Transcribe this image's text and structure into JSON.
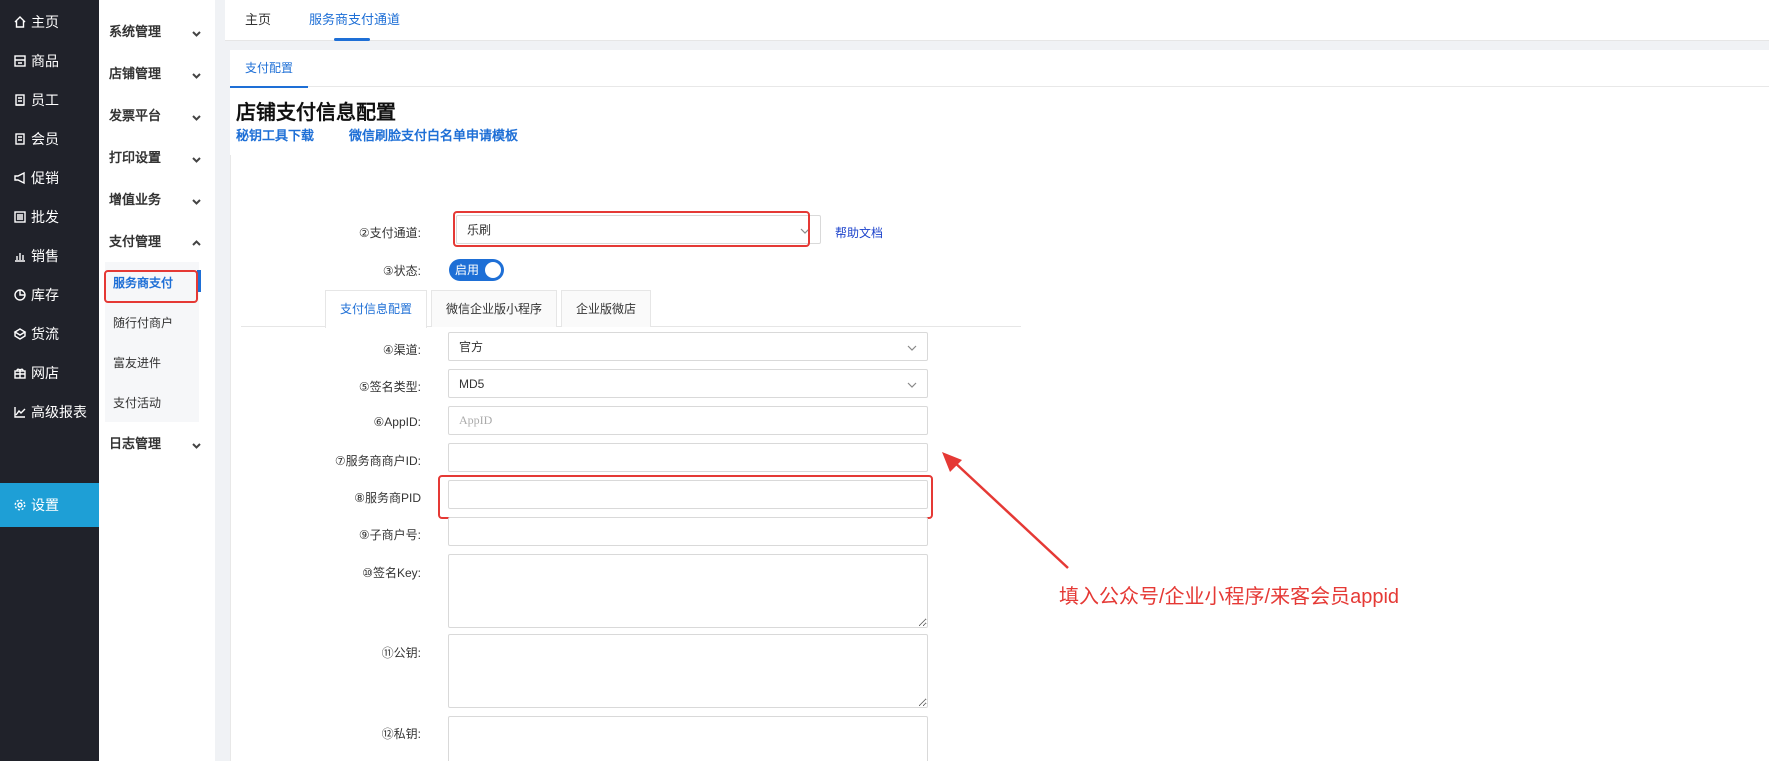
{
  "nav": {
    "items": [
      {
        "label": "主页",
        "icon": "home-icon"
      },
      {
        "label": "商品",
        "icon": "box-icon"
      },
      {
        "label": "员工",
        "icon": "staff-icon"
      },
      {
        "label": "会员",
        "icon": "member-icon"
      },
      {
        "label": "促销",
        "icon": "megaphone-icon"
      },
      {
        "label": "批发",
        "icon": "list-icon"
      },
      {
        "label": "销售",
        "icon": "bar-chart-icon"
      },
      {
        "label": "库存",
        "icon": "pie-chart-icon"
      },
      {
        "label": "货流",
        "icon": "cube-icon"
      },
      {
        "label": "网店",
        "icon": "gift-icon"
      },
      {
        "label": "高级报表",
        "icon": "line-chart-icon"
      },
      {
        "label": "设置",
        "icon": "gear-icon",
        "active": true
      }
    ]
  },
  "submenu": {
    "groups": [
      {
        "label": "系统管理"
      },
      {
        "label": "店铺管理"
      },
      {
        "label": "发票平台"
      },
      {
        "label": "打印设置"
      },
      {
        "label": "增值业务"
      },
      {
        "label": "支付管理",
        "expanded": true
      },
      {
        "label": "日志管理"
      }
    ],
    "children": [
      {
        "label": "服务商支付",
        "active": true
      },
      {
        "label": "随行付商户"
      },
      {
        "label": "富友进件"
      },
      {
        "label": "支付活动"
      }
    ]
  },
  "topbar": {
    "tabs": [
      {
        "label": "主页"
      },
      {
        "label": "服务商支付通道",
        "active": true
      }
    ]
  },
  "panel": {
    "tab": "支付配置",
    "title": "店铺支付信息配置",
    "links": [
      "秘钥工具下载",
      "微信刷脸支付白名单申请模板"
    ]
  },
  "form": {
    "channel_label": "②支付通道:",
    "channel_value": "乐刷",
    "help_link": "帮助文档",
    "status_label": "③状态:",
    "status_value": "启用",
    "tabs": [
      "支付信息配置",
      "微信企业版小程序",
      "企业版微店"
    ],
    "fields": {
      "route_label": "④渠道:",
      "route_value": "官方",
      "sign_type_label": "⑤签名类型:",
      "sign_type_value": "MD5",
      "appid_label": "⑥AppID:",
      "appid_placeholder": "AppID",
      "merchant_id_label": "⑦服务商商户ID:",
      "pid_label": "⑧服务商PID",
      "sub_merchant_label": "⑨子商户号:",
      "sign_key_label": "⑩签名Key:",
      "public_key_label": "⑪公钥:",
      "private_key_label": "⑫私钥:"
    }
  },
  "annotation": {
    "text": "填入公众号/企业小程序/来客会员appid",
    "color": "#e53935"
  },
  "colors": {
    "nav_bg": "#20222a",
    "nav_active": "#1e9fd6",
    "accent": "#1e6fd6",
    "highlight": "#e53935"
  }
}
